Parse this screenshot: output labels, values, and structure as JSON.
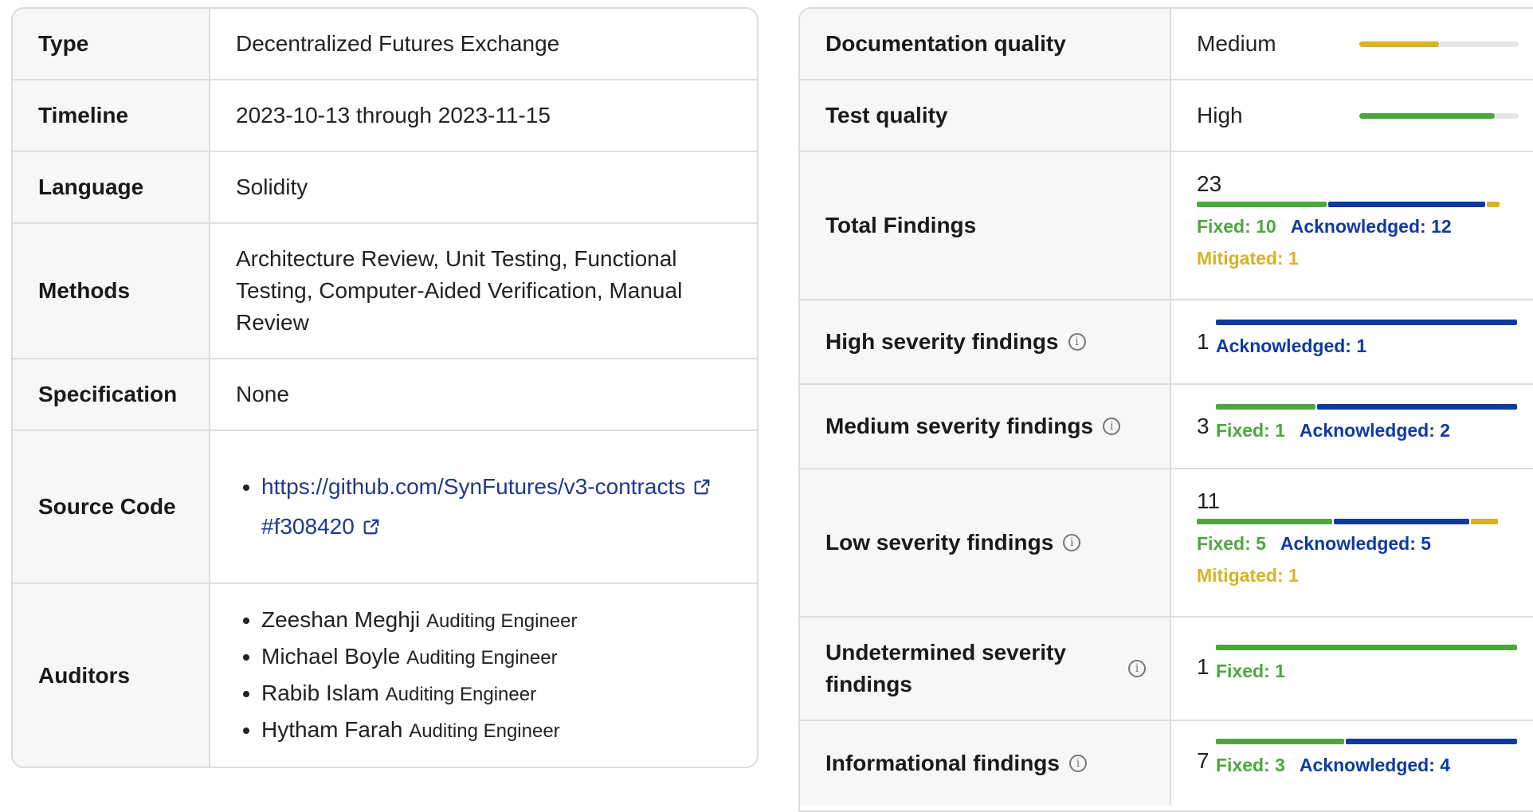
{
  "overview": {
    "type_label": "Type",
    "type_value": "Decentralized Futures Exchange",
    "timeline_label": "Timeline",
    "timeline_value": "2023-10-13 through 2023-11-15",
    "language_label": "Language",
    "language_value": "Solidity",
    "methods_label": "Methods",
    "methods_value": "Architecture Review, Unit Testing, Functional Testing, Computer-Aided Verification, Manual Review",
    "specification_label": "Specification",
    "specification_value": "None",
    "source_label": "Source Code",
    "source_links": [
      "https://github.com/SynFutures/v3-contracts",
      "#f308420"
    ],
    "auditors_label": "Auditors",
    "auditors": [
      {
        "name": "Zeeshan Meghji",
        "role": "Auditing Engineer"
      },
      {
        "name": "Michael Boyle",
        "role": "Auditing Engineer"
      },
      {
        "name": "Rabib Islam",
        "role": "Auditing Engineer"
      },
      {
        "name": "Hytham Farah",
        "role": "Auditing Engineer"
      }
    ]
  },
  "quality": {
    "documentation_label": "Documentation quality",
    "documentation_value": "Medium",
    "documentation_level": 0.5,
    "test_label": "Test quality",
    "test_value": "High",
    "test_level": 0.85
  },
  "findings": {
    "total": {
      "label": "Total Findings",
      "count": "23",
      "fixed": "Fixed: 10",
      "acknowledged": "Acknowledged: 12",
      "mitigated": "Mitigated: 1",
      "n_fixed": 10,
      "n_ack": 12,
      "n_mit": 1
    },
    "high": {
      "label": "High severity findings",
      "count": "1",
      "acknowledged": "Acknowledged: 1",
      "n_fixed": 0,
      "n_ack": 1,
      "n_mit": 0
    },
    "medium": {
      "label": "Medium severity findings",
      "count": "3",
      "fixed": "Fixed: 1",
      "acknowledged": "Acknowledged: 2",
      "n_fixed": 1,
      "n_ack": 2,
      "n_mit": 0
    },
    "low": {
      "label": "Low severity findings",
      "count": "11",
      "fixed": "Fixed: 5",
      "acknowledged": "Acknowledged: 5",
      "mitigated": "Mitigated: 1",
      "n_fixed": 5,
      "n_ack": 5,
      "n_mit": 1
    },
    "undetermined": {
      "label": "Undetermined severity findings",
      "count": "1",
      "fixed": "Fixed: 1",
      "n_fixed": 1,
      "n_ack": 0,
      "n_mit": 0
    },
    "informational": {
      "label": "Informational findings",
      "count": "7",
      "fixed": "Fixed: 3",
      "acknowledged": "Acknowledged: 4",
      "n_fixed": 3,
      "n_ack": 4,
      "n_mit": 0
    }
  },
  "colors": {
    "fixed": "#4ea640",
    "acknowledged": "#0f3aa0",
    "mitigated": "#d9b225",
    "link": "#1e3a8a"
  },
  "icons": {
    "external_link": "external-link-icon",
    "info": "info-icon"
  }
}
